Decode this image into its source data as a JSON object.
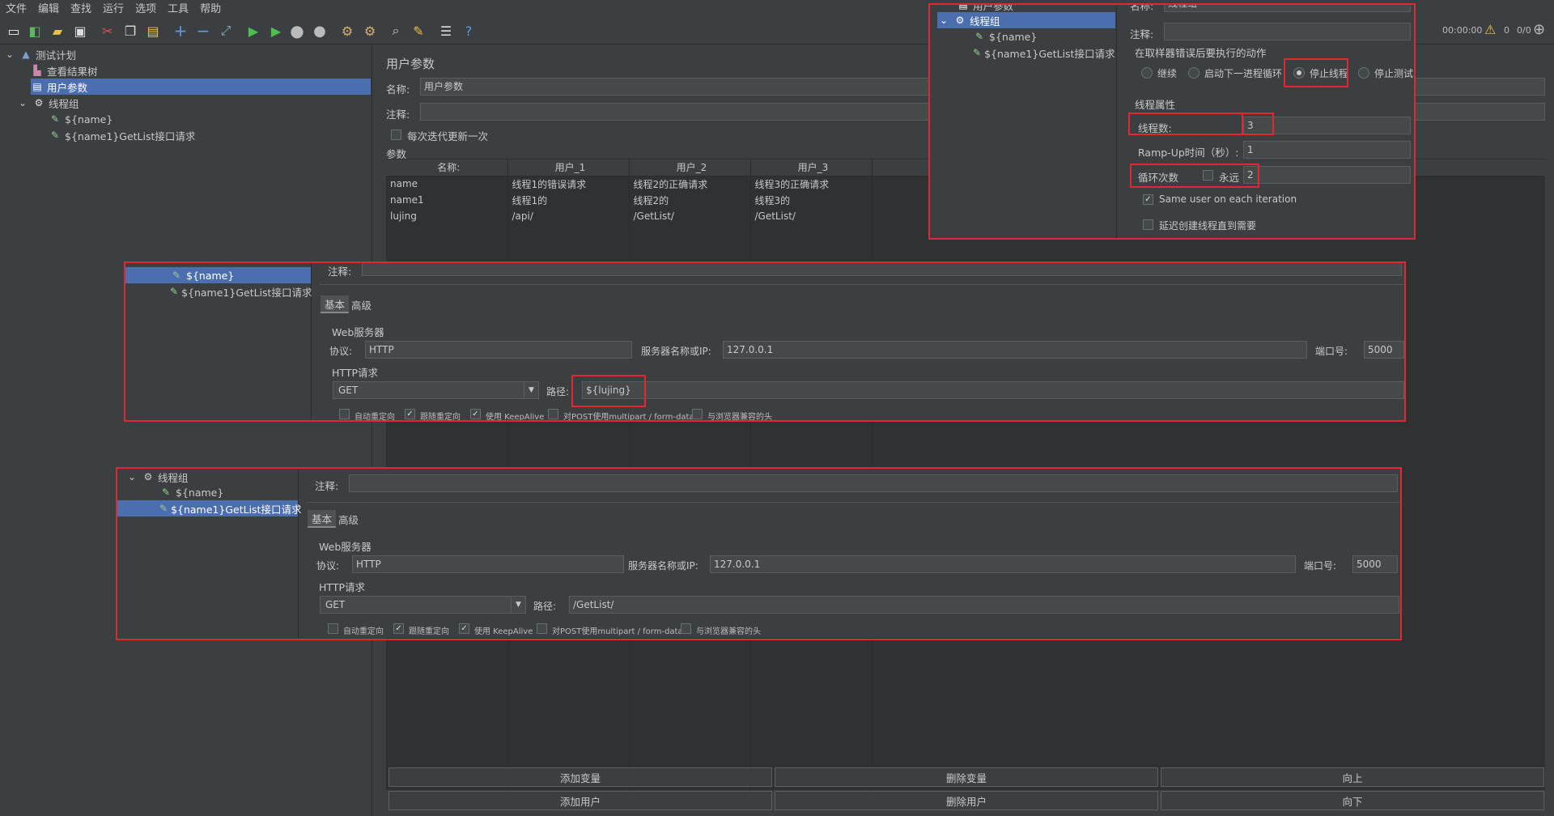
{
  "menu": [
    "文件",
    "编辑",
    "查找",
    "运行",
    "选项",
    "工具",
    "帮助"
  ],
  "toolbar_icons": [
    "new-icon",
    "templates-icon",
    "open-icon",
    "save-icon",
    "cut-icon",
    "copy-icon",
    "paste-icon",
    "expand-icon",
    "collapse-icon",
    "toggle-icon",
    "start-icon",
    "start-no-pause-icon",
    "stop-icon",
    "shutdown-icon",
    "clear-icon",
    "clear-all-icon",
    "search-icon",
    "reset-search-icon",
    "function-helper-icon",
    "help-icon"
  ],
  "status": {
    "timer": "00:00:00",
    "warnings": "0",
    "threads": "0/0"
  },
  "tree": {
    "root": "测试计划",
    "items": [
      "查看结果树",
      "用户参数",
      "线程组",
      "${name}",
      "${name1}GetList接口请求"
    ]
  },
  "user_params": {
    "title": "用户参数",
    "name_label": "名称:",
    "name_value": "用户参数",
    "comment_label": "注释:",
    "comment_value": "",
    "update_once_label": "每次迭代更新一次",
    "params_label": "参数",
    "columns": [
      "名称:",
      "用户_1",
      "用户_2",
      "用户_3"
    ],
    "rows": [
      [
        "name",
        "线程1的错误请求",
        "线程2的正确请求",
        "线程3的正确请求"
      ],
      [
        "name1",
        "线程1的",
        "线程2的",
        "线程3的"
      ],
      [
        "lujing",
        "/api/",
        "/GetList/",
        "/GetList/"
      ]
    ],
    "buttons": {
      "add_var": "添加变量",
      "del_var": "删除变量",
      "up": "向上",
      "add_user": "添加用户",
      "del_user": "删除用户",
      "down": "向下"
    }
  },
  "tg_overlay": {
    "tree_partial": "用户参数",
    "tree_group": "线程组",
    "tree_items": [
      "${name}",
      "${name1}GetList接口请求"
    ],
    "name_label": "名称:",
    "name_value": "线程组",
    "comment_label": "注释:",
    "error_action_label": "在取样器错误后要执行的动作",
    "actions": [
      "继续",
      "启动下一进程循环",
      "停止线程",
      "停止测试"
    ],
    "thread_props_label": "线程属性",
    "threads_label": "线程数:",
    "threads_value": "3",
    "rampup_label": "Ramp-Up时间（秒）:",
    "rampup_value": "1",
    "loop_label": "循环次数",
    "forever_label": "永远",
    "loop_value": "2",
    "same_user_label": "Same user on each iteration",
    "delay_label": "延迟创建线程直到需要"
  },
  "http1": {
    "tree_items": [
      "${name}",
      "${name1}GetList接口请求"
    ],
    "comment_label": "注释:",
    "tabs": [
      "基本",
      "高级"
    ],
    "web_server_label": "Web服务器",
    "protocol_label": "协议:",
    "protocol_value": "HTTP",
    "server_label": "服务器名称或IP:",
    "server_value": "127.0.0.1",
    "port_label": "端口号:",
    "port_value": "5000",
    "http_request_label": "HTTP请求",
    "method": "GET",
    "path_label": "路径:",
    "path_value": "${lujing}",
    "options": [
      "自动重定向",
      "跟随重定向",
      "使用 KeepAlive",
      "对POST使用multipart / form-data",
      "与浏览器兼容的头"
    ]
  },
  "http2": {
    "tree_group": "线程组",
    "tree_items": [
      "${name}",
      "${name1}GetList接口请求"
    ],
    "comment_label": "注释:",
    "tabs": [
      "基本",
      "高级"
    ],
    "web_server_label": "Web服务器",
    "protocol_label": "协议:",
    "protocol_value": "HTTP",
    "server_label": "服务器名称或IP:",
    "server_value": "127.0.0.1",
    "port_label": "端口号:",
    "port_value": "5000",
    "http_request_label": "HTTP请求",
    "method": "GET",
    "path_label": "路径:",
    "path_value": "/GetList/",
    "options": [
      "自动重定向",
      "跟随重定向",
      "使用 KeepAlive",
      "对POST使用multipart / form-data",
      "与浏览器兼容的头"
    ]
  },
  "colors": {
    "bg": "#3c3f41",
    "selection": "#4b6eaf",
    "highlight": "#e0282e"
  }
}
